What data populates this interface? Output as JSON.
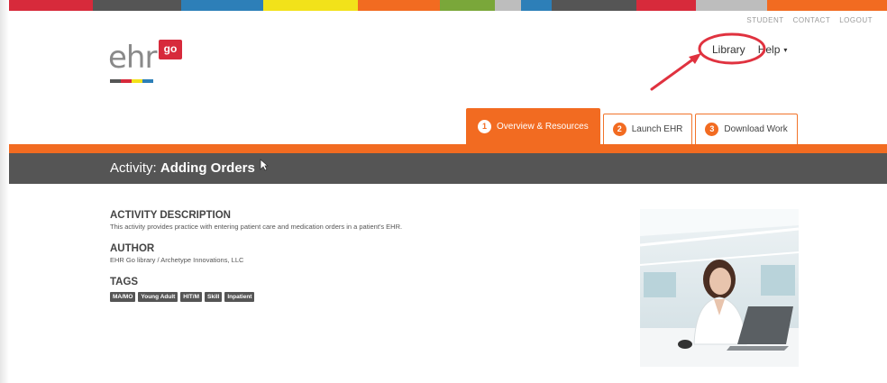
{
  "stripe_colors": [
    "#d72a3b",
    "#9b1c2a",
    "#555555",
    "#a6916b",
    "#2d7fb8",
    "#f2e21a",
    "#f26b21",
    "#7aa73a",
    "#bdbdbd",
    "#2d7fb8",
    "#555555",
    "#d72a3b",
    "#bdbdbd",
    "#f26b21"
  ],
  "utility_nav": {
    "student": "STUDENT",
    "contact": "CONTACT",
    "logout": "LOGOUT"
  },
  "logo": {
    "wordmark": "ehr",
    "badge": "go"
  },
  "main_nav": {
    "library": "Library",
    "help": "Help",
    "help_caret": "▾"
  },
  "tabs": [
    {
      "num": "1",
      "label": "Overview & Resources",
      "active": true
    },
    {
      "num": "2",
      "label": "Launch EHR",
      "active": false
    },
    {
      "num": "3",
      "label": "Download Work",
      "active": false
    }
  ],
  "activity": {
    "prefix": "Activity:",
    "name": "Adding Orders"
  },
  "description": {
    "heading": "ACTIVITY DESCRIPTION",
    "text": "This activity provides practice with entering patient care and medication orders in a patient's EHR."
  },
  "author": {
    "heading": "AUTHOR",
    "text": "EHR Go library / Archetype Innovations, LLC"
  },
  "tags": {
    "heading": "TAGS",
    "items": [
      "MA/MO",
      "Young Adult",
      "HIT/M",
      "Skill",
      "Inpatient"
    ]
  },
  "colors": {
    "accent": "#f26b21",
    "annotation": "#e0323f",
    "title_bar": "#555555"
  },
  "icons": {
    "annotation": "red-circle-and-arrow-icon",
    "cursor": "mouse-pointer-icon"
  }
}
